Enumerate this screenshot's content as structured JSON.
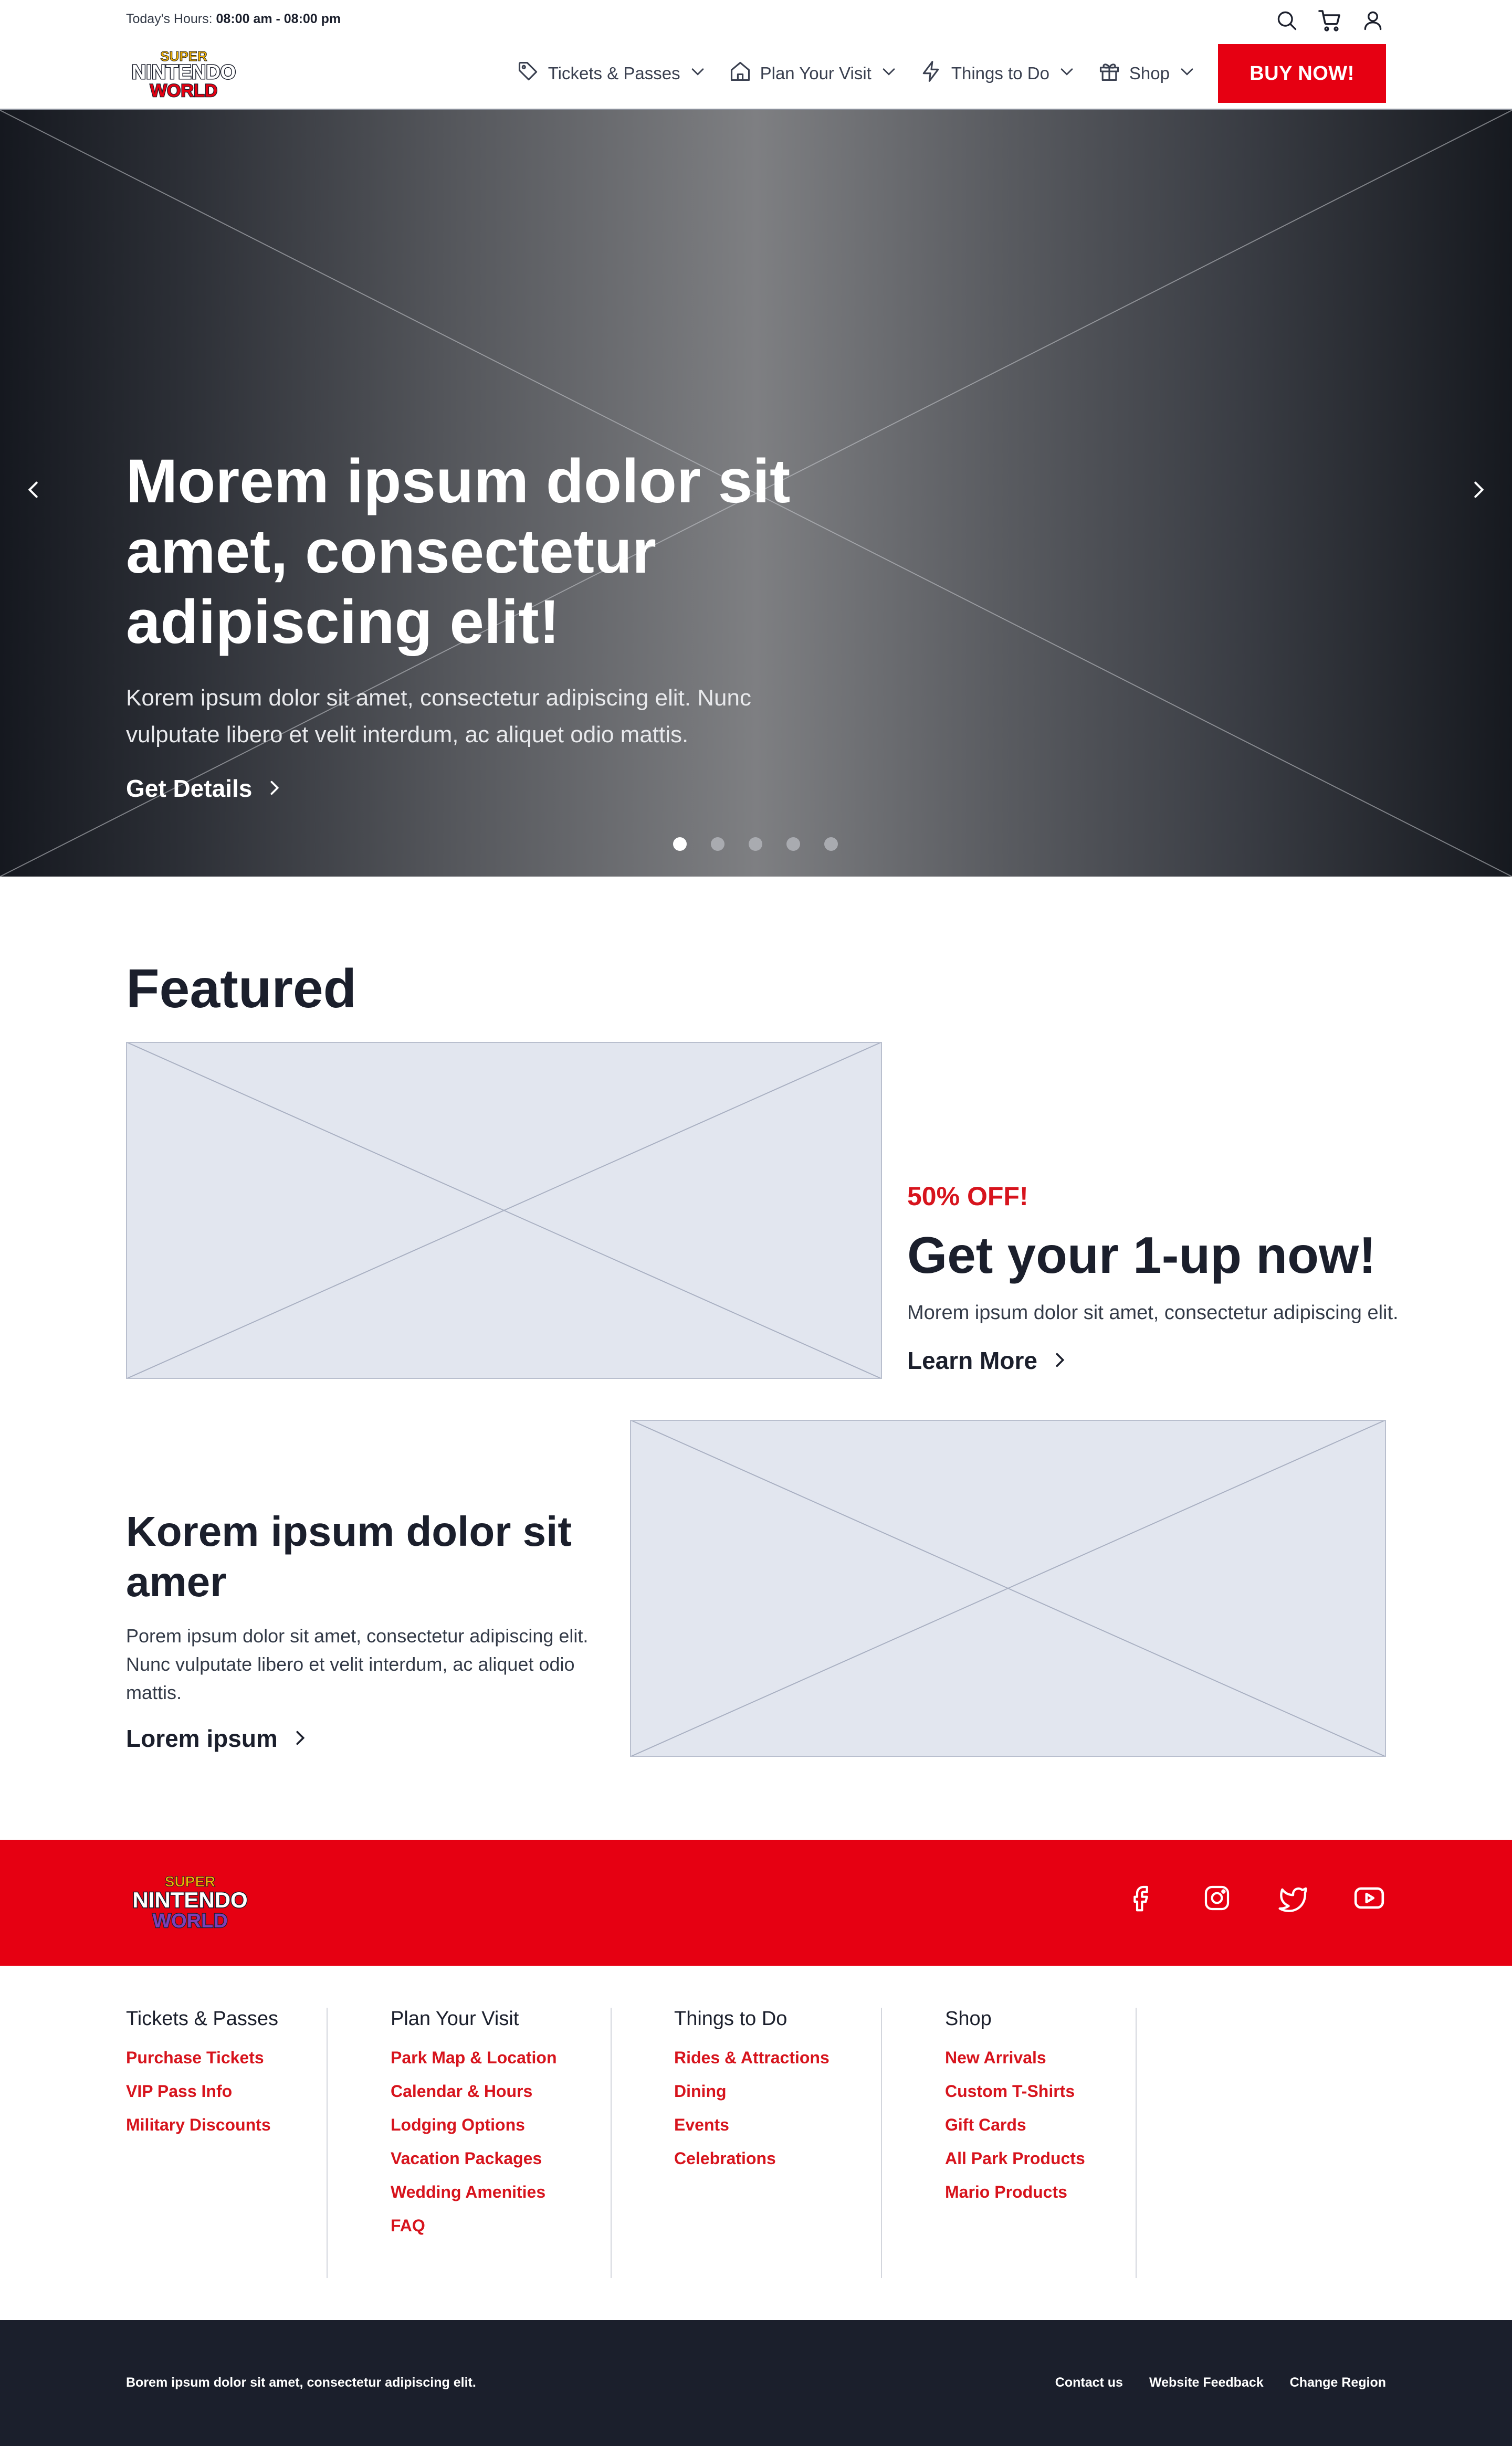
{
  "header": {
    "hours_label": "Today's Hours:",
    "hours_value": "08:00 am - 08:00 pm",
    "logo": {
      "line1": "SUPER",
      "line2": "NINTENDO",
      "line3": "WORLD"
    },
    "nav": [
      {
        "label": "Tickets & Passes",
        "icon": "tag-icon"
      },
      {
        "label": "Plan Your Visit",
        "icon": "house-icon"
      },
      {
        "label": "Things to Do",
        "icon": "lightning-icon"
      },
      {
        "label": "Shop",
        "icon": "gift-icon"
      }
    ],
    "buy_label": "BUY NOW!",
    "utility_icons": [
      "search-icon",
      "cart-icon",
      "user-icon"
    ]
  },
  "hero": {
    "title": "Morem ipsum dolor sit amet, consectetur adipiscing elit!",
    "subtitle": "Korem ipsum dolor sit amet, consectetur adipiscing elit. Nunc vulputate libero et velit interdum, ac aliquet odio mattis.",
    "cta": "Get Details",
    "slides": 5,
    "active_slide": 1
  },
  "featured": {
    "title": "Featured",
    "promo": {
      "badge": "50% OFF!",
      "title": "Get your 1-up now!",
      "desc": "Morem ipsum dolor sit amet, consectetur adipiscing elit.",
      "cta": "Learn More"
    },
    "card2": {
      "title": "Korem ipsum dolor sit amer",
      "desc": "Porem ipsum dolor sit amet, consectetur adipiscing elit. Nunc vulputate libero et velit interdum, ac aliquet odio mattis.",
      "cta": "Lorem ipsum"
    }
  },
  "footer": {
    "social": [
      "facebook-icon",
      "instagram-icon",
      "twitter-icon",
      "youtube-icon"
    ],
    "columns": [
      {
        "title": "Tickets & Passes",
        "links": [
          "Purchase Tickets",
          "VIP Pass Info",
          "Military Discounts"
        ]
      },
      {
        "title": "Plan Your Visit",
        "links": [
          "Park Map & Location",
          "Calendar & Hours",
          "Lodging Options",
          "Vacation Packages",
          "Wedding Amenities",
          "FAQ"
        ]
      },
      {
        "title": "Things to Do",
        "links": [
          "Rides & Attractions",
          "Dining",
          "Events",
          "Celebrations"
        ]
      },
      {
        "title": "Shop",
        "links": [
          "New Arrivals",
          "Custom T-Shirts",
          "Gift Cards",
          "All Park Products",
          "Mario Products"
        ]
      }
    ],
    "bottom_text": "Borem ipsum dolor sit amet, consectetur adipiscing elit.",
    "bottom_links": [
      "Contact us",
      "Website Feedback",
      "Change Region"
    ]
  },
  "colors": {
    "brand_red": "#e60012",
    "link_red": "#d7141d",
    "dark": "#1b1f2c",
    "placeholder": "#e2e6ef"
  }
}
